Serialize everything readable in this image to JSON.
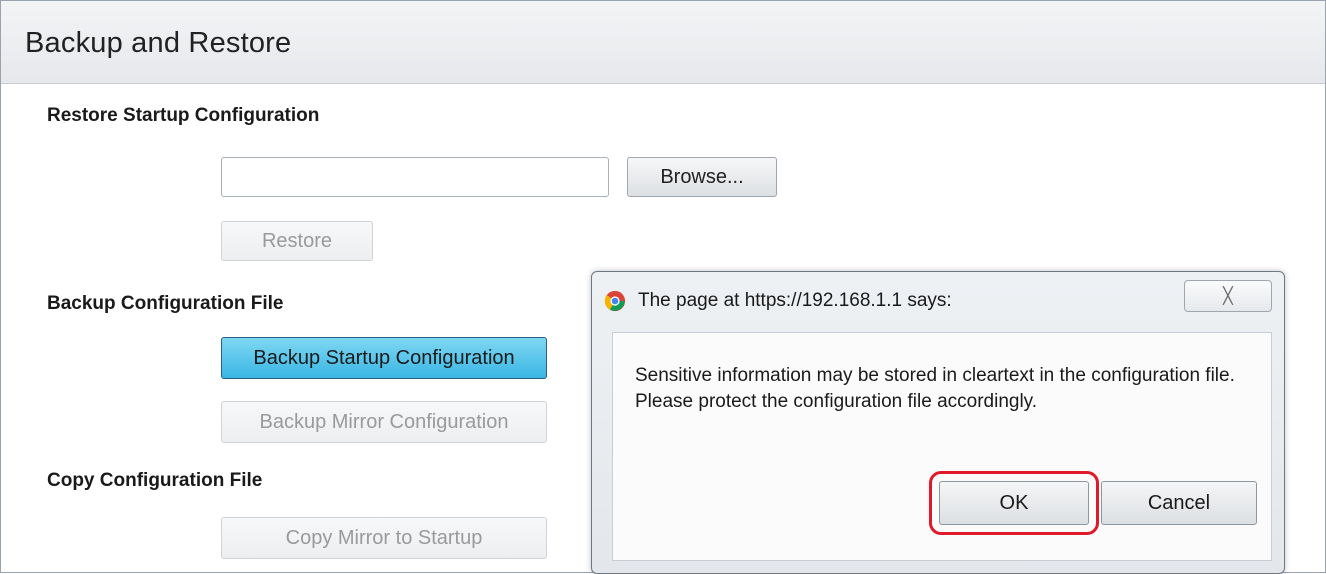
{
  "page": {
    "title": "Backup and Restore"
  },
  "restore": {
    "heading": "Restore Startup Configuration",
    "file_input_value": "",
    "browse_label": "Browse...",
    "restore_label": "Restore"
  },
  "backup": {
    "heading": "Backup Configuration File",
    "startup_label": "Backup Startup Configuration",
    "mirror_label": "Backup Mirror Configuration"
  },
  "copy": {
    "heading": "Copy Configuration File",
    "mirror_to_startup_label": "Copy Mirror to Startup"
  },
  "dialog": {
    "title": "The page at https://192.168.1.1 says:",
    "close_glyph": "╳",
    "message": "Sensitive information may be stored in cleartext in the configuration file. Please protect the configuration file accordingly.",
    "ok_label": "OK",
    "cancel_label": "Cancel",
    "highlight_color": "#e0192b"
  },
  "colors": {
    "primary_button": "#39b6e4"
  }
}
